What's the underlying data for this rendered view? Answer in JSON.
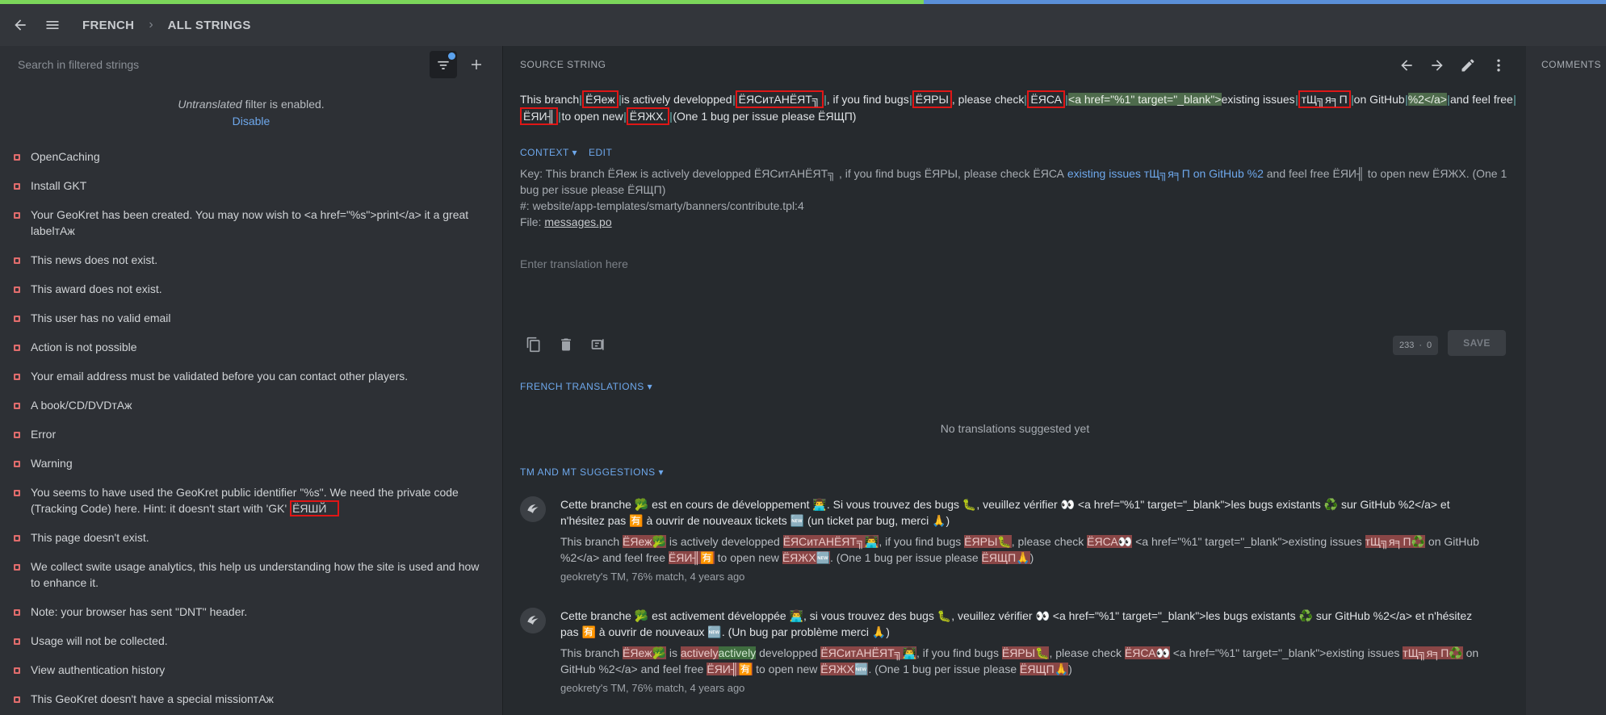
{
  "progress": {
    "translated_fraction": 0.575
  },
  "topbar": {
    "locale": "FRENCH",
    "sep": "›",
    "view": "ALL STRINGS"
  },
  "sidebar": {
    "search_placeholder": "Search in filtered strings",
    "filter_word": "Untranslated",
    "filter_rest": " filter is enabled.",
    "disable_label": "Disable",
    "strings": [
      "OpenCaching",
      "Install GKT",
      "Your GeoKret has been created. You may now wish to <a href=\"%s\">print</a> it a great labelтАж",
      "This news does not exist.",
      "This award does not exist.",
      "This user has no valid email",
      "Action is not possible",
      "Your email address must be validated before you can contact other players.",
      "A book/CD/DVDтАж",
      "Error",
      "Warning",
      "You seems to have used the GeoKret public identifier \"%s\". We need the private code (Tracking Code) here. Hint: it doesn't start with 'GK'",
      "This page doesn't exist.",
      "We collect swite usage analytics, this help us understanding how the site is used and how to enhance it.",
      "Note: your browser has sent \"DNT\" header.",
      "Usage will not be collected.",
      "View authentication history",
      "This GeoKret doesn't have a special missionтАж"
    ],
    "highlight_suffix": "ЁЯШЙ"
  },
  "source": {
    "label": "SOURCE STRING",
    "t1": "This branch",
    "m1": "ЁЯеж",
    "t2": "is actively developped",
    "m2": "ЁЯСитАНЁЯТ╗",
    "t3": ", if you find bugs",
    "m3": "ЁЯРЫ",
    "t4": ", please check",
    "m4": "ЁЯСА",
    "p1": "<a href=\"",
    "p2": "%1",
    "p3": "\" target=\"_blank\">",
    "t5": "existing issues",
    "m5": "тЩ╗я╕П",
    "t6": "on GitHub",
    "p4": "%2",
    "p5": "</a>",
    "t7": "and feel free",
    "m6": "ЁЯИ╢",
    "t8": "to open new",
    "m7": "ЁЯЖХ.",
    "t9": "(One 1 bug per issue please ЁЯЩП)"
  },
  "context": {
    "tab_context": "CONTEXT",
    "tab_edit": "EDIT",
    "key_prefix": "Key: This branch ЁЯеж is actively developped ЁЯСитАНЁЯТ╗ , if you find bugs ЁЯРЫ, please check ЁЯСА ",
    "key_link": "existing issues тЩ╗я╕П on GitHub %2",
    "key_suffix": " and feel free ЁЯИ╢ to open new ЁЯЖХ. (One 1 bug per issue please ЁЯЩП)",
    "ref": "#: website/app-templates/smarty/banners/contribute.tpl:4",
    "file_label": "File: ",
    "file_name": "messages.po"
  },
  "editor": {
    "placeholder": "Enter translation here",
    "count_left": "233",
    "count_right": "0",
    "save_label": "SAVE"
  },
  "french_translations": {
    "label": "FRENCH TRANSLATIONS",
    "empty": "No translations suggested yet"
  },
  "tm": {
    "label": "TM AND MT SUGGESTIONS",
    "entries": [
      {
        "target": "Cette branche 🥦 est en cours de développement 👨‍💻. Si vous trouvez des bugs 🐛, veuillez vérifier 👀 <a href=\"%1\" target=\"_blank\">les bugs existants ♻️ sur GitHub %2</a> et n'hésitez pas 🈶 à ouvrir de nouveaux tickets 🆕 (un ticket par bug, merci 🙏)",
        "s1": "This branch ",
        "d1": "ЁЯеж🥦",
        "s2": " is actively developped ",
        "d2": "ЁЯСитАНЁЯТ╗👨‍💻",
        "s3": ", if you find bugs ",
        "d3": "ЁЯРЫ🐛",
        "s4": ", please check ",
        "d4": "ЁЯСА👀",
        "s5": " <a href=\"%1\" target=\"_blank\">existing issues ",
        "d5": "тЩ╗я╕П♻️",
        "s6": " on GitHub %2</a> and feel free ",
        "d6": "ЁЯИ╢🈶",
        "s7": " to open new ",
        "d7": "ЁЯЖХ🆕",
        "s8": ". (One 1 bug per issue please ",
        "d8": "ЁЯЩП🙏",
        "s9": ")",
        "meta": "geokrety's TM, 76% match, 4 years ago"
      },
      {
        "target": "Cette branche 🥦 est activement développée 👨‍💻, si vous trouvez des bugs 🐛, veuillez vérifier 👀 <a href=\"%1\" target=\"_blank\">les bugs existants ♻️ sur GitHub %2</a> et n'hésitez pas 🈶 à ouvrir de nouveaux 🆕. (Un bug par problème merci 🙏)",
        "s1": "This branch ",
        "d1": "ЁЯеж🥦",
        "s2": " is ",
        "del_word": "actively",
        "ins_word": "actively",
        "s2b": " developped ",
        "d2": "ЁЯСитАНЁЯТ╗👨‍💻",
        "s3": ", if you find bugs ",
        "d3": "ЁЯРЫ🐛",
        "s4": ", please check ",
        "d4": "ЁЯСА👀",
        "s5": " <a href=\"%1\" target=\"_blank\">existing issues ",
        "d5": "тЩ╗я╕П♻️",
        "s6": " on GitHub %2</a> and feel free ",
        "d6": "ЁЯИ╢🈶",
        "s7": " to open new ",
        "d7": "ЁЯЖХ🆕",
        "s8": ". (One 1 bug per issue please ",
        "d8": "ЁЯЩП🙏",
        "s9": ")",
        "meta": "geokrety's TM, 76% match, 4 years ago"
      }
    ]
  },
  "comments": {
    "label": "COMMENTS"
  }
}
